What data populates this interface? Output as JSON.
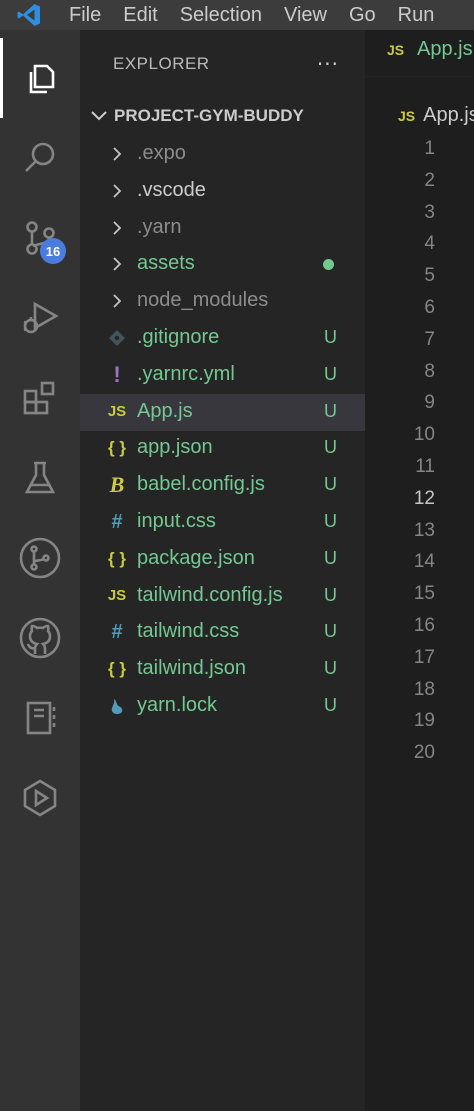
{
  "menu": [
    "File",
    "Edit",
    "Selection",
    "View",
    "Go",
    "Run"
  ],
  "activity": {
    "items": [
      "explorer-icon",
      "search-icon",
      "source-control-icon",
      "run-debug-icon",
      "extensions-icon",
      "testing-icon",
      "git-graph-icon",
      "github-icon",
      "notebook-icon",
      "remote-icon"
    ],
    "scm_badge": "16"
  },
  "sidebar": {
    "title": "EXPLORER",
    "more": "···",
    "project": "PROJECT-GYM-BUDDY",
    "rows": [
      {
        "name": ".expo",
        "kind": "folder",
        "status": ""
      },
      {
        "name": ".vscode",
        "kind": "folder",
        "status": ""
      },
      {
        "name": ".yarn",
        "kind": "folder",
        "status": ""
      },
      {
        "name": "assets",
        "kind": "folder",
        "status": "dot"
      },
      {
        "name": "node_modules",
        "kind": "folder",
        "status": ""
      },
      {
        "name": ".gitignore",
        "kind": "git",
        "status": "U"
      },
      {
        "name": ".yarnrc.yml",
        "kind": "yml",
        "status": "U"
      },
      {
        "name": "App.js",
        "kind": "js",
        "status": "U"
      },
      {
        "name": "app.json",
        "kind": "json",
        "status": "U"
      },
      {
        "name": "babel.config.js",
        "kind": "babel",
        "status": "U"
      },
      {
        "name": "input.css",
        "kind": "css",
        "status": "U"
      },
      {
        "name": "package.json",
        "kind": "json",
        "status": "U"
      },
      {
        "name": "tailwind.config.js",
        "kind": "js",
        "status": "U"
      },
      {
        "name": "tailwind.css",
        "kind": "css",
        "status": "U"
      },
      {
        "name": "tailwind.json",
        "kind": "json",
        "status": "U"
      },
      {
        "name": "yarn.lock",
        "kind": "yarn",
        "status": "U"
      }
    ],
    "selected": "App.js"
  },
  "editor": {
    "tab_badge": "JS",
    "tab": "App.js",
    "breadcrumb_badge": "JS",
    "breadcrumb": "App.js",
    "lines": [
      "1",
      "2",
      "3",
      "4",
      "5",
      "6",
      "7",
      "8",
      "9",
      "10",
      "11",
      "12",
      "13",
      "14",
      "15",
      "16",
      "17",
      "18",
      "19",
      "20"
    ],
    "current_line": "12"
  },
  "colors": {
    "activity_bg": "#333333",
    "sidebar_bg": "#252526",
    "editor_bg": "#1e1e1e",
    "untracked": "#73c991",
    "ignored": "#8c8c8c",
    "js_yellow": "#cbcb41",
    "badge_blue": "#4a7cde"
  }
}
